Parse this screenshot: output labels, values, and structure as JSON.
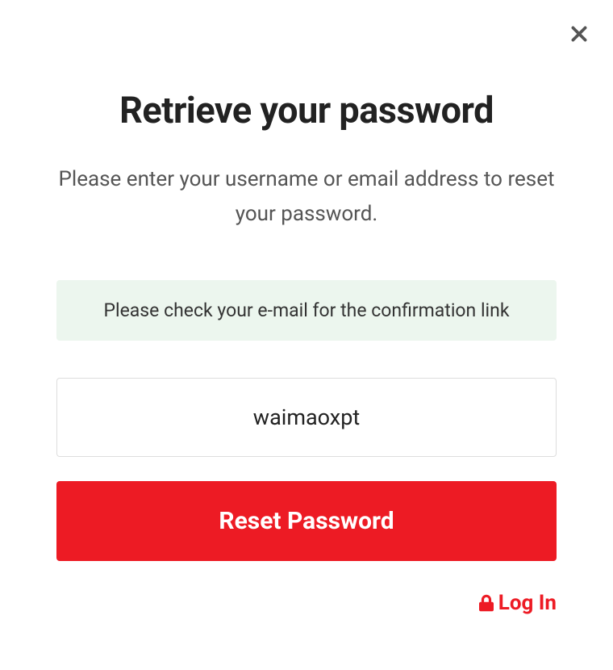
{
  "modal": {
    "title": "Retrieve your password",
    "subtitle": "Please enter your username or email address to reset your password.",
    "alert": "Please check your e-mail for the confirmation link",
    "input_value": "waimaoxpt",
    "submit_label": "Reset Password",
    "login_link_label": "Log In"
  },
  "colors": {
    "accent": "#ed1b24",
    "alert_bg": "#ecf6ee"
  }
}
